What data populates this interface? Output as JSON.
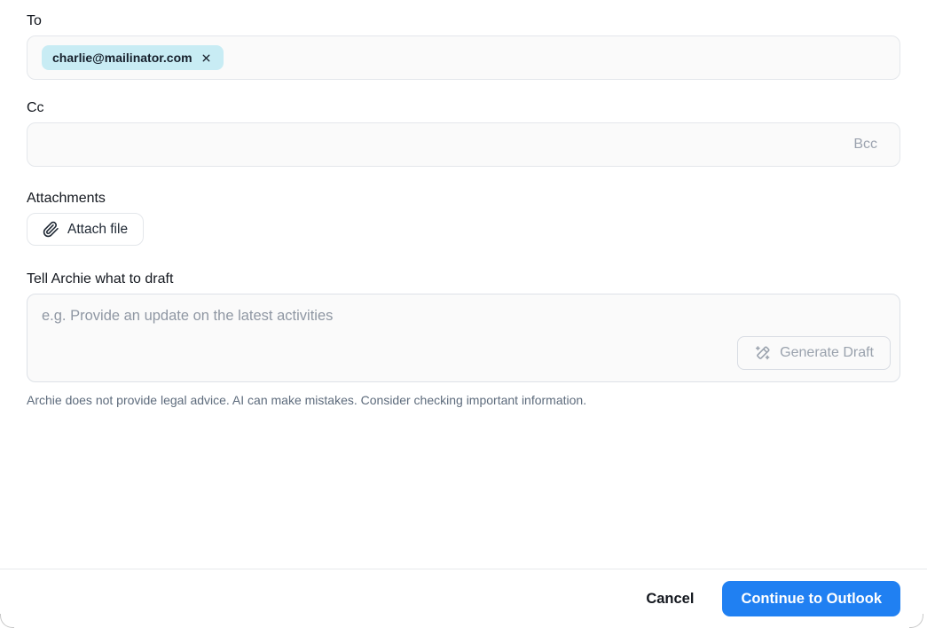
{
  "fields": {
    "to": {
      "label": "To",
      "chips": [
        {
          "email": "charlie@mailinator.com"
        }
      ]
    },
    "cc": {
      "label": "Cc",
      "bcc_toggle_label": "Bcc"
    },
    "attachments": {
      "label": "Attachments",
      "attach_button_label": "Attach file"
    },
    "prompt": {
      "label": "Tell Archie what to draft",
      "placeholder": "e.g. Provide an update on the latest activities",
      "generate_button_label": "Generate Draft"
    }
  },
  "disclaimer": "Archie does not provide legal advice. AI can make mistakes. Consider checking important information.",
  "footer": {
    "cancel_label": "Cancel",
    "continue_label": "Continue to Outlook"
  },
  "colors": {
    "primary_button": "#2080f2",
    "chip_background": "#c8ecf4",
    "input_background": "#fafafa",
    "border": "#e4e7eb",
    "muted_text": "#9ca3af",
    "disclaimer_text": "#5d6b7c"
  }
}
